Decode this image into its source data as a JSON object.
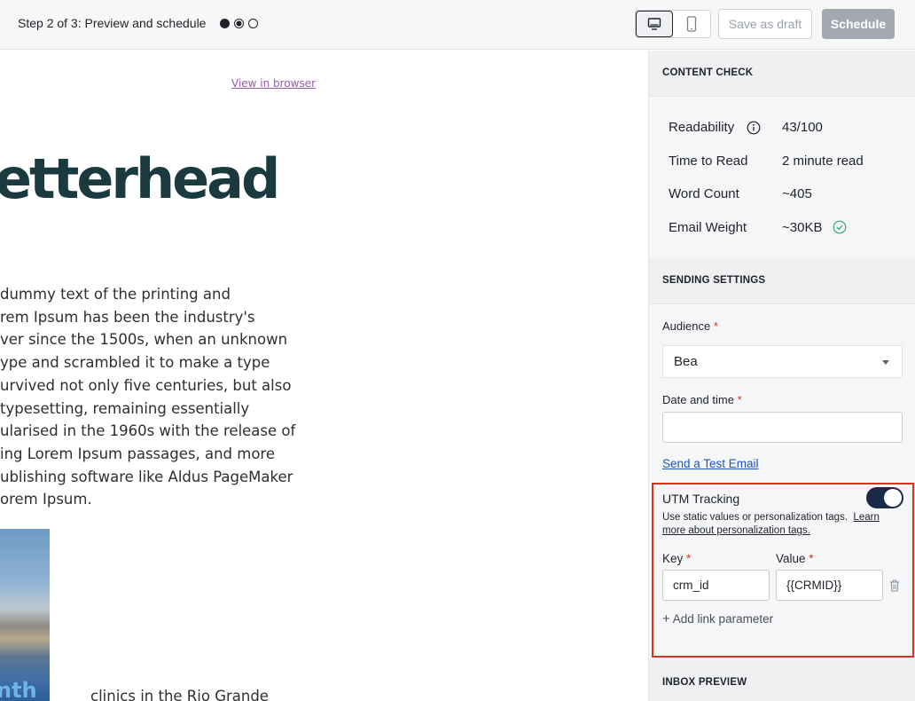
{
  "header": {
    "step_title": "Step 2 of 3: Preview and schedule",
    "steps": [
      "complete",
      "current",
      "pending"
    ],
    "device_toggle": [
      "desktop-icon",
      "mobile-icon"
    ],
    "active_device": "desktop",
    "save_draft_label": "Save as draft",
    "schedule_label": "Schedule"
  },
  "preview": {
    "view_in_browser": "View in browser",
    "logo_text": "etterhead",
    "body_lines": [
      "dummy text of the printing and",
      "rem Ipsum has been the industry's",
      "ver since the 1500s, when an unknown",
      "ype and scrambled it to make a type",
      "urvived not only five centuries, but also",
      " typesetting, remaining essentially",
      "ularised in the 1960s with the release of",
      "ing Lorem Ipsum passages, and more",
      "ublishing software like Aldus PageMaker",
      "orem Ipsum."
    ],
    "photo_text": "nth",
    "fragment_text": "clinics in the Rio Grande"
  },
  "content_check": {
    "header": "CONTENT CHECK",
    "readability_label": "Readability",
    "readability_value": "43/100",
    "time_label": "Time to Read",
    "time_value": "2 minute read",
    "word_count_label": "Word Count",
    "word_count_value": "~405",
    "weight_label": "Email Weight",
    "weight_value": "~30KB"
  },
  "sending": {
    "header": "SENDING SETTINGS",
    "audience_label": "Audience",
    "audience_value": "Bea",
    "datetime_label": "Date and time",
    "datetime_value": "",
    "required_mark": "*",
    "test_email_link": "Send a Test Email"
  },
  "utm": {
    "title": "UTM Tracking",
    "enabled": true,
    "help_text": "Use static values or personalization tags.",
    "help_link": "Learn more about personalization tags.",
    "key_label": "Key",
    "value_label": "Value",
    "key_value": "crm_id",
    "value_value": "{{CRMID}}",
    "add_param_label": "Add link parameter",
    "highlight_color": "#e0301e"
  },
  "inbox_preview": {
    "header": "INBOX PREVIEW"
  }
}
